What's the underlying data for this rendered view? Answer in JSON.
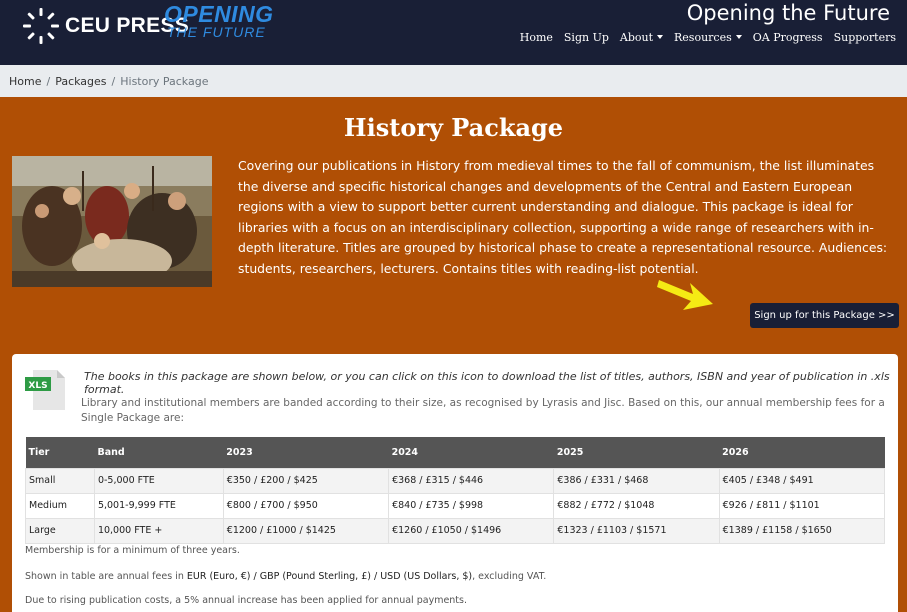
{
  "header": {
    "logo_text": "CEU PRESS",
    "logo_mark_icon": "ceu-press-sunburst-icon",
    "opening_main": "OPENING",
    "opening_sub": "THE FUTURE",
    "site_title": "Opening the Future",
    "nav": [
      {
        "label": "Home"
      },
      {
        "label": "Sign Up"
      },
      {
        "label": "About",
        "dropdown": true
      },
      {
        "label": "Resources",
        "dropdown": true
      },
      {
        "label": "OA Progress"
      },
      {
        "label": "Supporters"
      }
    ]
  },
  "breadcrumb": {
    "items": [
      "Home",
      "Packages"
    ],
    "current": "History Package",
    "separator": "/"
  },
  "hero": {
    "title": "History Package",
    "description": "Covering our publications in History from medieval times to the fall of communism, the list illuminates the diverse and specific historical changes and developments of the Central and Eastern European regions with a view to support better current understanding and dialogue. This package is ideal for libraries with a focus on an interdisciplinary collection, supporting a wide range of researchers with in-depth literature. Titles are grouped by historical phase to create a representational resource. Audiences: students, researchers, lecturers. Contains titles with reading-list potential.",
    "image_icon": "painting-image",
    "arrow_icon": "yellow-arrow-icon",
    "signup_label": "Sign up for this Package >>"
  },
  "card": {
    "xls_icon_label": "XLS",
    "download_note": "The books in this package are shown below, or you can click on this icon to download the list of titles, authors, ISBN and year of publication in .xls format.",
    "band_note": "Library and institutional members are banded according to their size, as recognised by Lyrasis and Jisc. Based on this, our annual membership fees for a Single Package are:",
    "table": {
      "headers": [
        "Tier",
        "Band",
        "2023",
        "2024",
        "2025",
        "2026"
      ],
      "rows": [
        [
          "Small",
          "0-5,000 FTE",
          "€350 / £200 / $425",
          "€368 / £315 / $446",
          "€386 / £331 / $468",
          "€405 / £348 / $491"
        ],
        [
          "Medium",
          "5,001-9,999 FTE",
          "€800 / £700 / $950",
          "€840 / £735 / $998",
          "€882 / £772 / $1048",
          "€926 / £811 / $1101"
        ],
        [
          "Large",
          "10,000 FTE +",
          "€1200 / £1000 / $1425",
          "€1260 / £1050 / $1496",
          "€1323 / £1103 / $1571",
          "€1389 / £1158 / $1650"
        ]
      ]
    },
    "footnote_minimum": "Membership is for a minimum of three years.",
    "footnote_currency_prefix": "Shown in table are annual fees in ",
    "footnote_currency_bold": "EUR (Euro, €) / GBP (Pound Sterling, £) / USD (US Dollars, $)",
    "footnote_currency_suffix": ", excluding VAT.",
    "footnote_increase": "Due to rising publication costs, a 5% annual increase has been applied for annual payments."
  },
  "colors": {
    "header_bg": "#191f36",
    "hero_bg": "#b04f05",
    "accent_blue": "#2f8be0",
    "table_header": "#555555",
    "arrow_yellow": "#f5ea14"
  }
}
